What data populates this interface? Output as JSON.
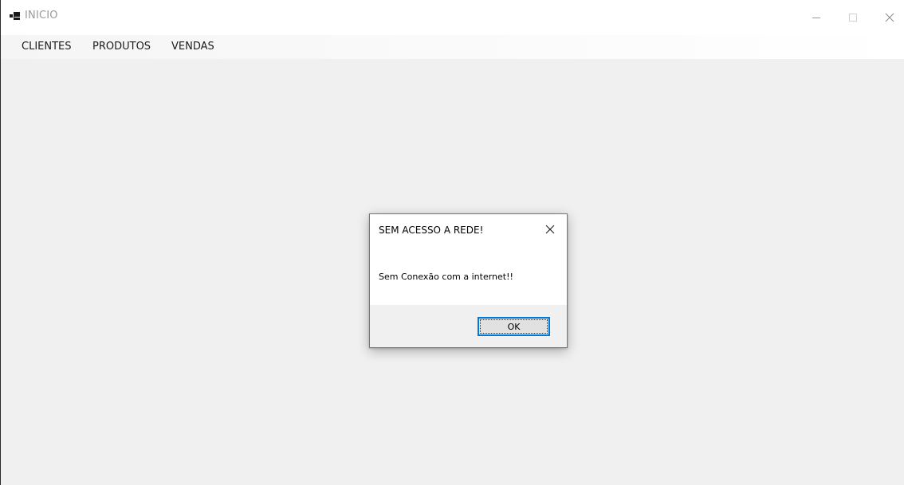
{
  "window": {
    "title": "INICIO",
    "icon": "app-window-icon",
    "controls": [
      "minimize-icon",
      "maximize-icon",
      "close-icon"
    ]
  },
  "menu": {
    "items": [
      {
        "label": "CLIENTES"
      },
      {
        "label": "PRODUTOS"
      },
      {
        "label": "VENDAS"
      }
    ]
  },
  "dialog": {
    "title": "SEM ACESSO A REDE!",
    "message": "Sem Conexão com a internet!!",
    "ok_label": "OK",
    "close_icon": "close-icon"
  },
  "colors": {
    "background": "#f0f0f0",
    "titlebar": "#ffffff",
    "accent": "#0078d7",
    "title_text": "#9a9a9a"
  }
}
